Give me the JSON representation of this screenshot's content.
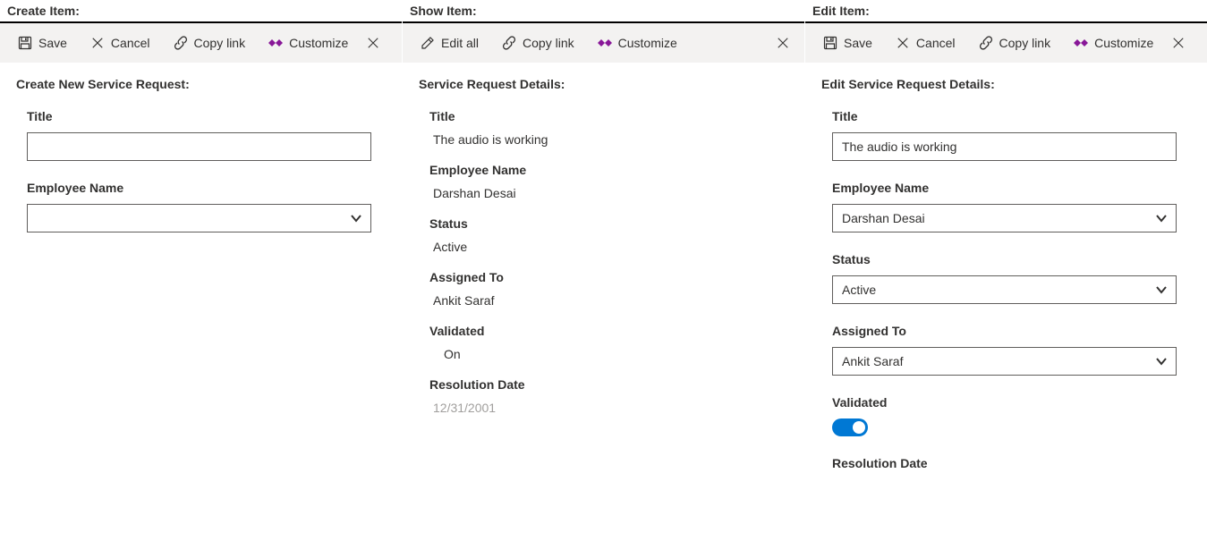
{
  "toolbar": {
    "save": "Save",
    "cancel": "Cancel",
    "copy_link": "Copy link",
    "edit_all": "Edit all",
    "customize": "Customize"
  },
  "create": {
    "panel_title": "Create Item:",
    "heading": "Create New Service Request:",
    "fields": {
      "title_label": "Title",
      "title_value": "",
      "employee_label": "Employee Name",
      "employee_value": ""
    }
  },
  "show": {
    "panel_title": "Show Item:",
    "heading": "Service Request Details:",
    "fields": {
      "title_label": "Title",
      "title_value": "The audio is working",
      "employee_label": "Employee Name",
      "employee_value": "Darshan Desai",
      "status_label": "Status",
      "status_value": "Active",
      "assigned_label": "Assigned To",
      "assigned_value": "Ankit Saraf",
      "validated_label": "Validated",
      "validated_value": "On",
      "resolution_label": "Resolution Date",
      "resolution_value": "12/31/2001"
    }
  },
  "edit": {
    "panel_title": "Edit Item:",
    "heading": "Edit Service Request Details:",
    "fields": {
      "title_label": "Title",
      "title_value": "The audio is working",
      "employee_label": "Employee Name",
      "employee_value": "Darshan Desai",
      "status_label": "Status",
      "status_value": "Active",
      "assigned_label": "Assigned To",
      "assigned_value": "Ankit Saraf",
      "validated_label": "Validated",
      "validated_on": true,
      "resolution_label": "Resolution Date"
    }
  }
}
